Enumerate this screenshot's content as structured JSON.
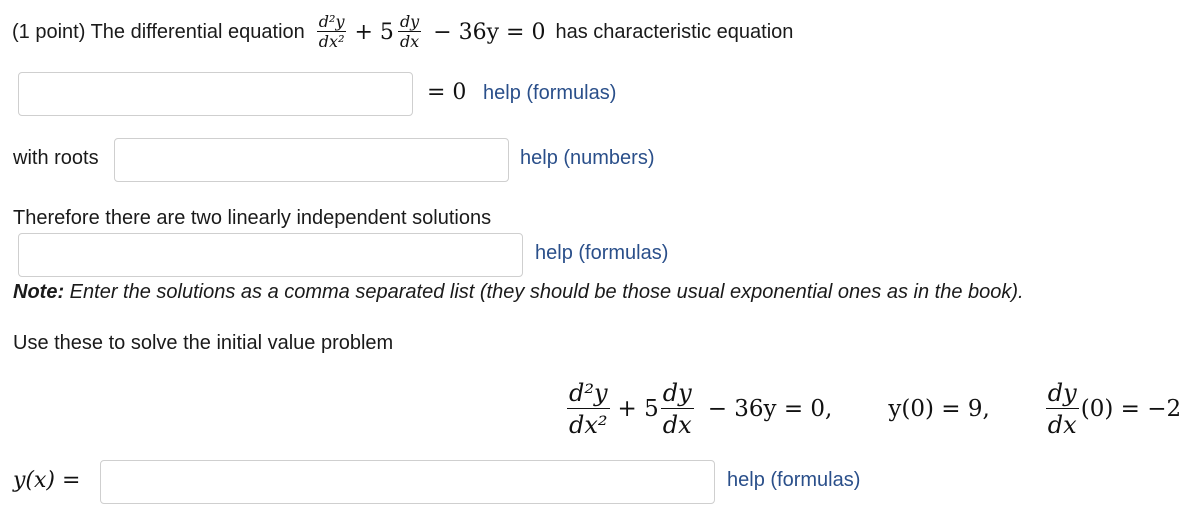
{
  "problem": {
    "point_label": "(1 point) The differential equation",
    "eq_d2y": "d²y",
    "eq_dx2": "dx²",
    "eq_plus5": "+ 5",
    "eq_dy": "dy",
    "eq_dx": "dx",
    "eq_rest": "− 36y = 0",
    "has_char_eq": "has characteristic equation"
  },
  "char_eq": {
    "input_value": "",
    "equals_zero": "= 0",
    "help": "help (formulas)"
  },
  "roots": {
    "label": "with roots",
    "input_value": "",
    "help": "help (numbers)"
  },
  "solutions": {
    "label": "Therefore there are two linearly independent solutions",
    "input_value": "",
    "help": "help (formulas)",
    "note_bold": "Note:",
    "note_text": "Enter the solutions as a comma separated list (they should be those usual exponential ones as in the book)."
  },
  "ivp": {
    "label": "Use these to solve the initial value problem",
    "d2y": "d²y",
    "dx2": "dx²",
    "plus5": "+ 5",
    "dy": "dy",
    "dx": "dx",
    "rest": "− 36y = 0,",
    "cond1": "y(0) = 9,",
    "cond2_dy": "dy",
    "cond2_dx": "dx",
    "cond2_rest": "(0) = −2"
  },
  "answer": {
    "label": "y(x) =",
    "input_value": "",
    "help": "help (formulas)"
  }
}
